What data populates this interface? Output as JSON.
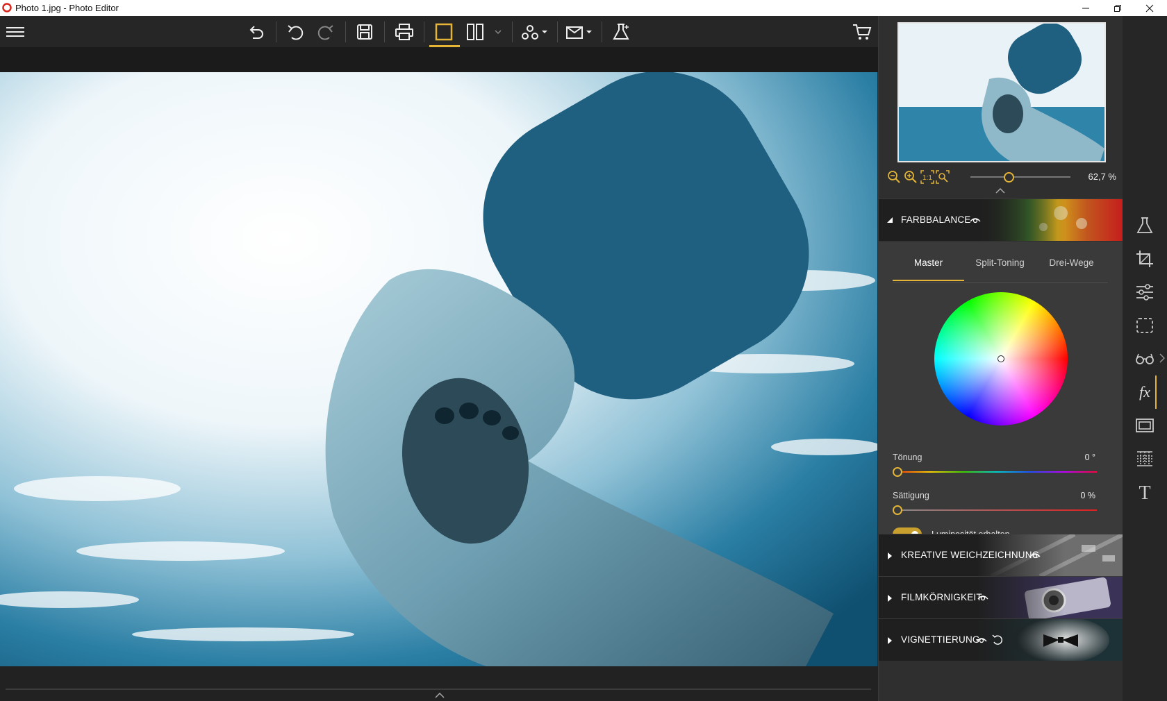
{
  "window": {
    "title": "Photo 1.jpg - Photo Editor",
    "controls": [
      "minimize",
      "restore",
      "close"
    ]
  },
  "toolbar": {
    "items": [
      "menu-icon",
      "undo-history-icon",
      "undo-icon",
      "redo-icon",
      "save-icon",
      "print-icon",
      "single-view-icon",
      "split-view-icon",
      "dropdown-icon",
      "share-icon",
      "send-icon",
      "effects-lab-icon",
      "cart-icon"
    ],
    "active": "single-view-icon",
    "accent": "#e3b436"
  },
  "navigator": {
    "zoom_value": "62,7 %",
    "zoom_fraction": 0.35
  },
  "sections": {
    "farbbalance": {
      "label": "FARBBALANCE",
      "expanded": true
    },
    "weichzeichnung": {
      "label": "KREATIVE WEICHZEICHNUNG",
      "expanded": false
    },
    "filmkoernigkeit": {
      "label": "FILMKÖRNIGKEIT",
      "expanded": false
    },
    "vignettierung": {
      "label": "VIGNETTIERUNG",
      "expanded": false
    }
  },
  "color_balance": {
    "tabs": [
      "Master",
      "Split-Toning",
      "Drei-Wege"
    ],
    "active_tab": "Master",
    "hue_label": "Tönung",
    "hue_value": "0 °",
    "saturation_label": "Sättigung",
    "saturation_value": "0 %",
    "preserve_luminosity_label": "Luminosität erhalten",
    "preserve_luminosity": true
  },
  "rail": {
    "items": [
      "lab-flask-icon",
      "crop-icon",
      "adjust-sliders-icon",
      "selection-icon",
      "glasses-icon",
      "fx-icon",
      "frame-icon",
      "texture-icon",
      "text-icon"
    ],
    "active": "fx-icon"
  }
}
